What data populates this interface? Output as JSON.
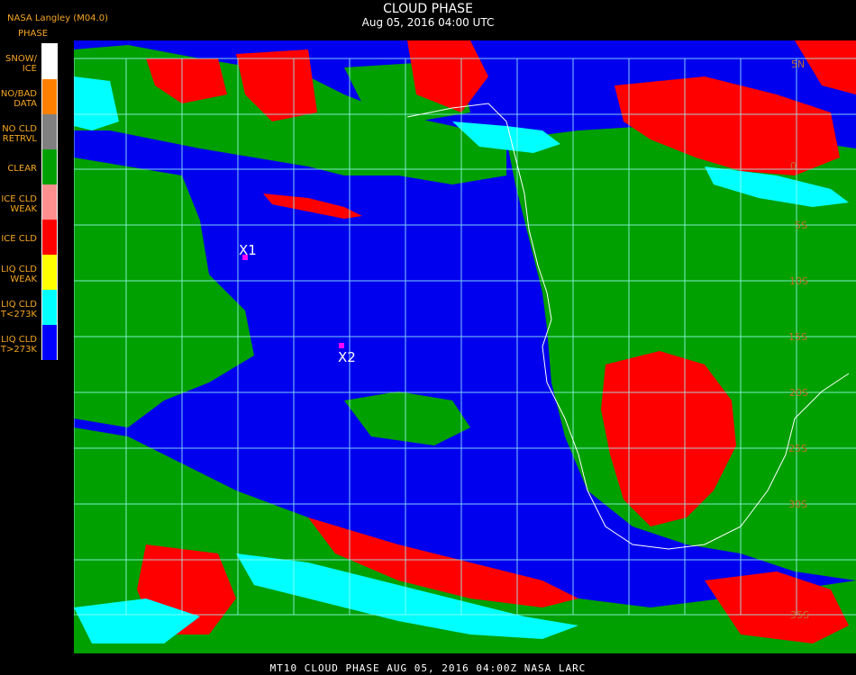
{
  "header": {
    "title": "CLOUD PHASE",
    "subtitle": "Aug 05, 2016 04:00 UTC",
    "provider": "NASA Langley (M04.0)"
  },
  "legend": {
    "title": "PHASE",
    "items": [
      {
        "label": "SNOW/\nICE",
        "color": "#ffffff"
      },
      {
        "label": "NO/BAD\nDATA",
        "color": "#ff8000"
      },
      {
        "label": "NO CLD\nRETRVL",
        "color": "#808080"
      },
      {
        "label": "CLEAR",
        "color": "#00a000"
      },
      {
        "label": "ICE CLD\nWEAK",
        "color": "#ff9090"
      },
      {
        "label": "ICE CLD",
        "color": "#ff0000"
      },
      {
        "label": "LIQ CLD\nWEAK",
        "color": "#ffff00"
      },
      {
        "label": "LIQ CLD\nT<273K",
        "color": "#00ffff"
      },
      {
        "label": "LIQ CLD\nT>273K",
        "color": "#0000ff"
      }
    ]
  },
  "map": {
    "markers": [
      {
        "label": "X1",
        "color": "#ff00ff"
      },
      {
        "label": "X2",
        "color": "#ff00ff"
      }
    ],
    "lat_labels": [
      "5N",
      "0",
      "5S",
      "10S",
      "15S",
      "20S",
      "25S",
      "30S",
      "35S"
    ],
    "colors": {
      "clear": "#00a000",
      "ice": "#ff0000",
      "liq_cold": "#00ffff",
      "liq_warm": "#0000ee",
      "grid": "#a0ffff",
      "coast": "#ffffff"
    }
  },
  "footer": {
    "text": "MT10  CLOUD PHASE   AUG 05, 2016 04:00Z  NASA LARC"
  }
}
